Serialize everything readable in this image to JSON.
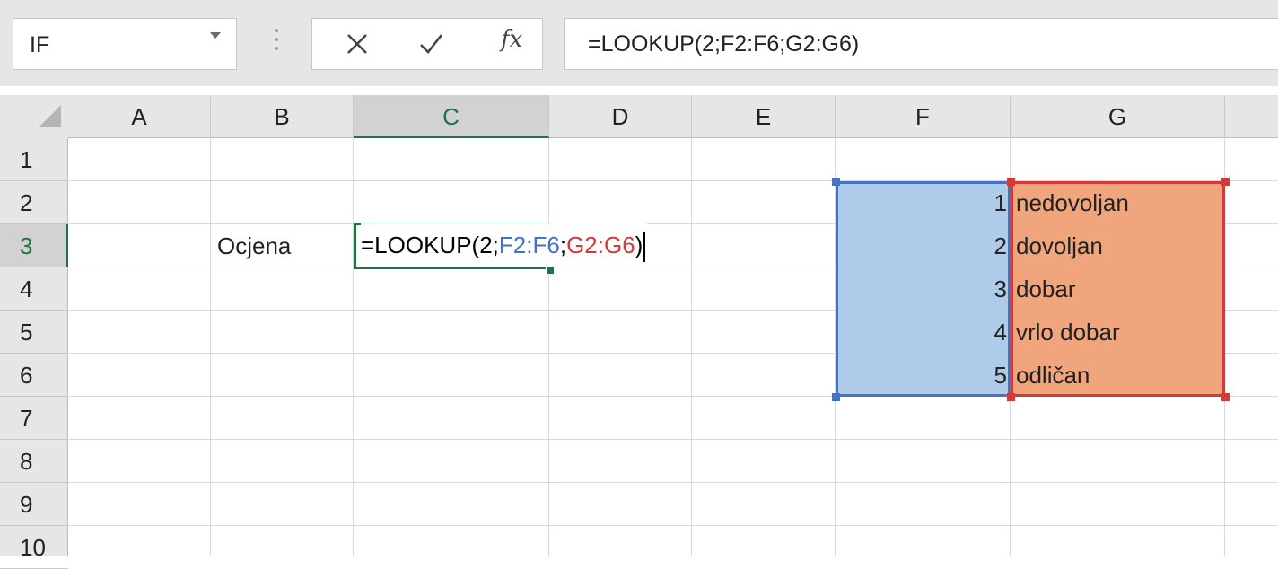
{
  "name_box": {
    "value": "IF"
  },
  "formula_bar": {
    "cancel_icon": "close-icon",
    "enter_icon": "check-icon",
    "fx_label": "fx",
    "formula": "=LOOKUP(2;F2:F6;G2:G6)"
  },
  "columns": [
    "A",
    "B",
    "C",
    "D",
    "E",
    "F",
    "G"
  ],
  "rows": [
    "1",
    "2",
    "3",
    "4",
    "5",
    "6",
    "7",
    "8",
    "9",
    "10"
  ],
  "active_column": "C",
  "active_row": "3",
  "cells": {
    "B3": "Ocjena",
    "F2": "1",
    "G2": "nedovoljan",
    "F3": "2",
    "G3": "dovoljan",
    "F4": "3",
    "G4": "dobar",
    "F5": "4",
    "G5": "vrlo dobar",
    "F6": "5",
    "G6": "odličan"
  },
  "edit": {
    "prefix": "=LOOKUP(2;",
    "ref1": "F2:F6",
    "sep": ";",
    "ref2": "G2:G6",
    "suffix": ")"
  },
  "colors": {
    "accent_green": "#217346",
    "range_blue": "#4472c4",
    "range_blue_fill": "#aecbe9",
    "range_red": "#d33b3b",
    "range_red_fill": "#f0a57c"
  }
}
